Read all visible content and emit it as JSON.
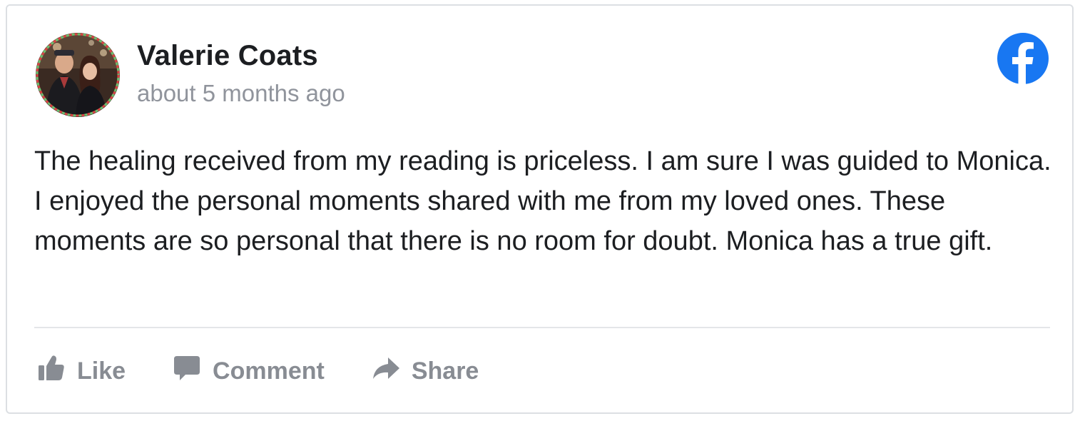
{
  "post": {
    "author": "Valerie Coats",
    "timestamp": "about 5 months ago",
    "text": "The healing received from my reading is priceless. I am sure I was guided to Monica. I enjoyed the personal moments shared with me from my loved ones. These moments are so personal that there is no room for doubt. Monica has a true gift.",
    "avatar_icon": "profile-photo-icon",
    "platform_icon": "facebook-logo-icon"
  },
  "actions": {
    "like_label": "Like",
    "comment_label": "Comment",
    "share_label": "Share",
    "like_icon": "thumbs-up-icon",
    "comment_icon": "speech-bubble-icon",
    "share_icon": "share-arrow-icon"
  },
  "colors": {
    "facebook_blue": "#1877f2",
    "muted_gray": "#888c93",
    "timestamp_gray": "#90949c",
    "text_dark": "#1c1e21"
  }
}
